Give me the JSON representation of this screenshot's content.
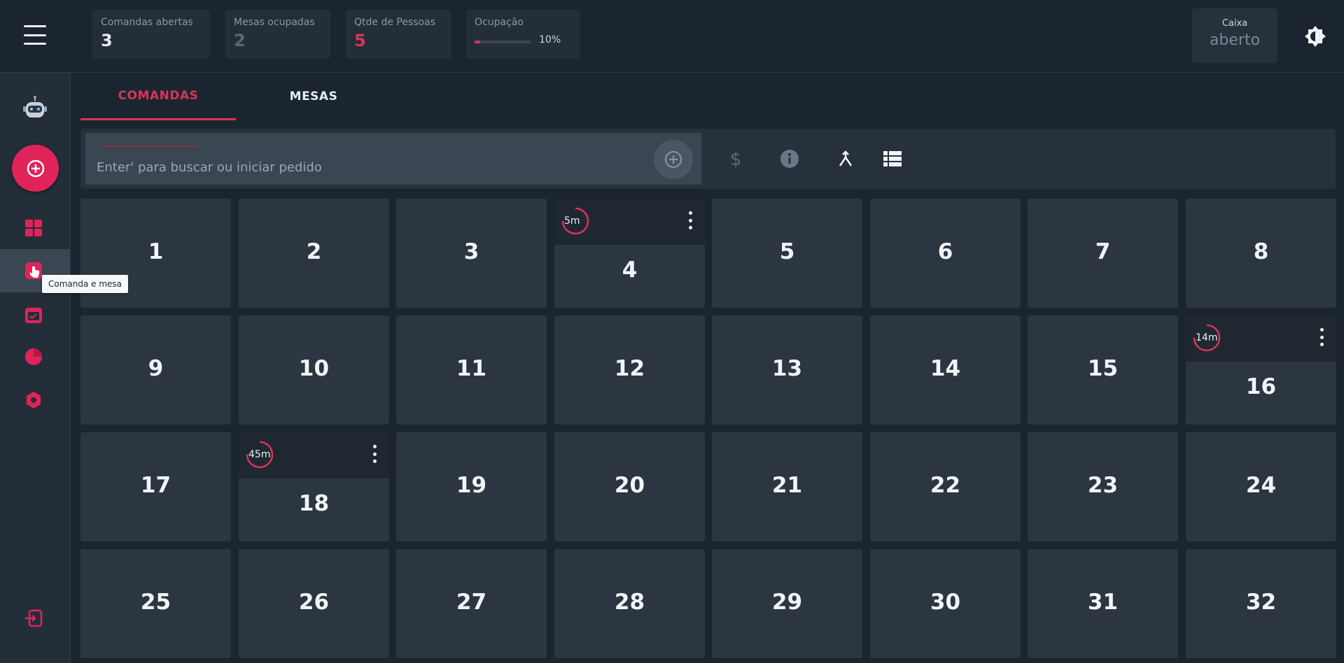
{
  "header": {
    "stats": [
      {
        "label": "Comandas abertas",
        "value": "3"
      },
      {
        "label": "Mesas ocupadas",
        "value": "2"
      },
      {
        "label": "Qtde de Pessoas",
        "value": "5"
      },
      {
        "label": "Ocupação",
        "value": "10%",
        "fraction": 0.1
      }
    ],
    "caixa": {
      "label": "Caixa",
      "status": "aberto"
    }
  },
  "sidebar": {
    "icons": [
      "robot-avatar-icon",
      "plus-circle-icon",
      "dashboard-icon",
      "comanda-mesa-icon",
      "calendar-icon",
      "pie-chart-icon",
      "settings-icon",
      "logout-icon"
    ],
    "tooltip": "Comanda e mesa"
  },
  "tabs": [
    {
      "label": "COMANDAS",
      "active": true
    },
    {
      "label": "MESAS",
      "active": false
    }
  ],
  "search": {
    "placeholder": "Enter' para buscar ou iniciar pedido"
  },
  "toolbar_icons": [
    "dollar-icon",
    "info-icon",
    "merge-icon",
    "list-view-icon"
  ],
  "accent_color": "#d9345a",
  "cards": [
    {
      "number": "1"
    },
    {
      "number": "2"
    },
    {
      "number": "3"
    },
    {
      "number": "4",
      "open": true,
      "time": "5m"
    },
    {
      "number": "5"
    },
    {
      "number": "6"
    },
    {
      "number": "7"
    },
    {
      "number": "8"
    },
    {
      "number": "9"
    },
    {
      "number": "10"
    },
    {
      "number": "11"
    },
    {
      "number": "12"
    },
    {
      "number": "13"
    },
    {
      "number": "14"
    },
    {
      "number": "15"
    },
    {
      "number": "16",
      "open": true,
      "time": "14m"
    },
    {
      "number": "17"
    },
    {
      "number": "18",
      "open": true,
      "time": "45m"
    },
    {
      "number": "19"
    },
    {
      "number": "20"
    },
    {
      "number": "21"
    },
    {
      "number": "22"
    },
    {
      "number": "23"
    },
    {
      "number": "24"
    },
    {
      "number": "25"
    },
    {
      "number": "26"
    },
    {
      "number": "27"
    },
    {
      "number": "28"
    },
    {
      "number": "29"
    },
    {
      "number": "30"
    },
    {
      "number": "31"
    },
    {
      "number": "32"
    }
  ]
}
